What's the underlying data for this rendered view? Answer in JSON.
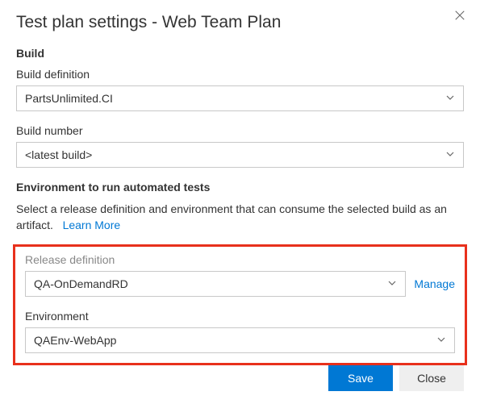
{
  "dialog": {
    "title": "Test plan settings - Web Team Plan"
  },
  "build": {
    "heading": "Build",
    "definition_label": "Build definition",
    "definition_value": "PartsUnlimited.CI",
    "number_label": "Build number",
    "number_value": "<latest build>"
  },
  "environment": {
    "heading": "Environment to run automated tests",
    "description": "Select a release definition and environment that can consume the selected build as an artifact.",
    "learn_more": "Learn More",
    "release_def_label": "Release definition",
    "release_def_value": "QA-OnDemandRD",
    "manage_link": "Manage",
    "env_label": "Environment",
    "env_value": "QAEnv-WebApp"
  },
  "footer": {
    "save": "Save",
    "close": "Close"
  }
}
